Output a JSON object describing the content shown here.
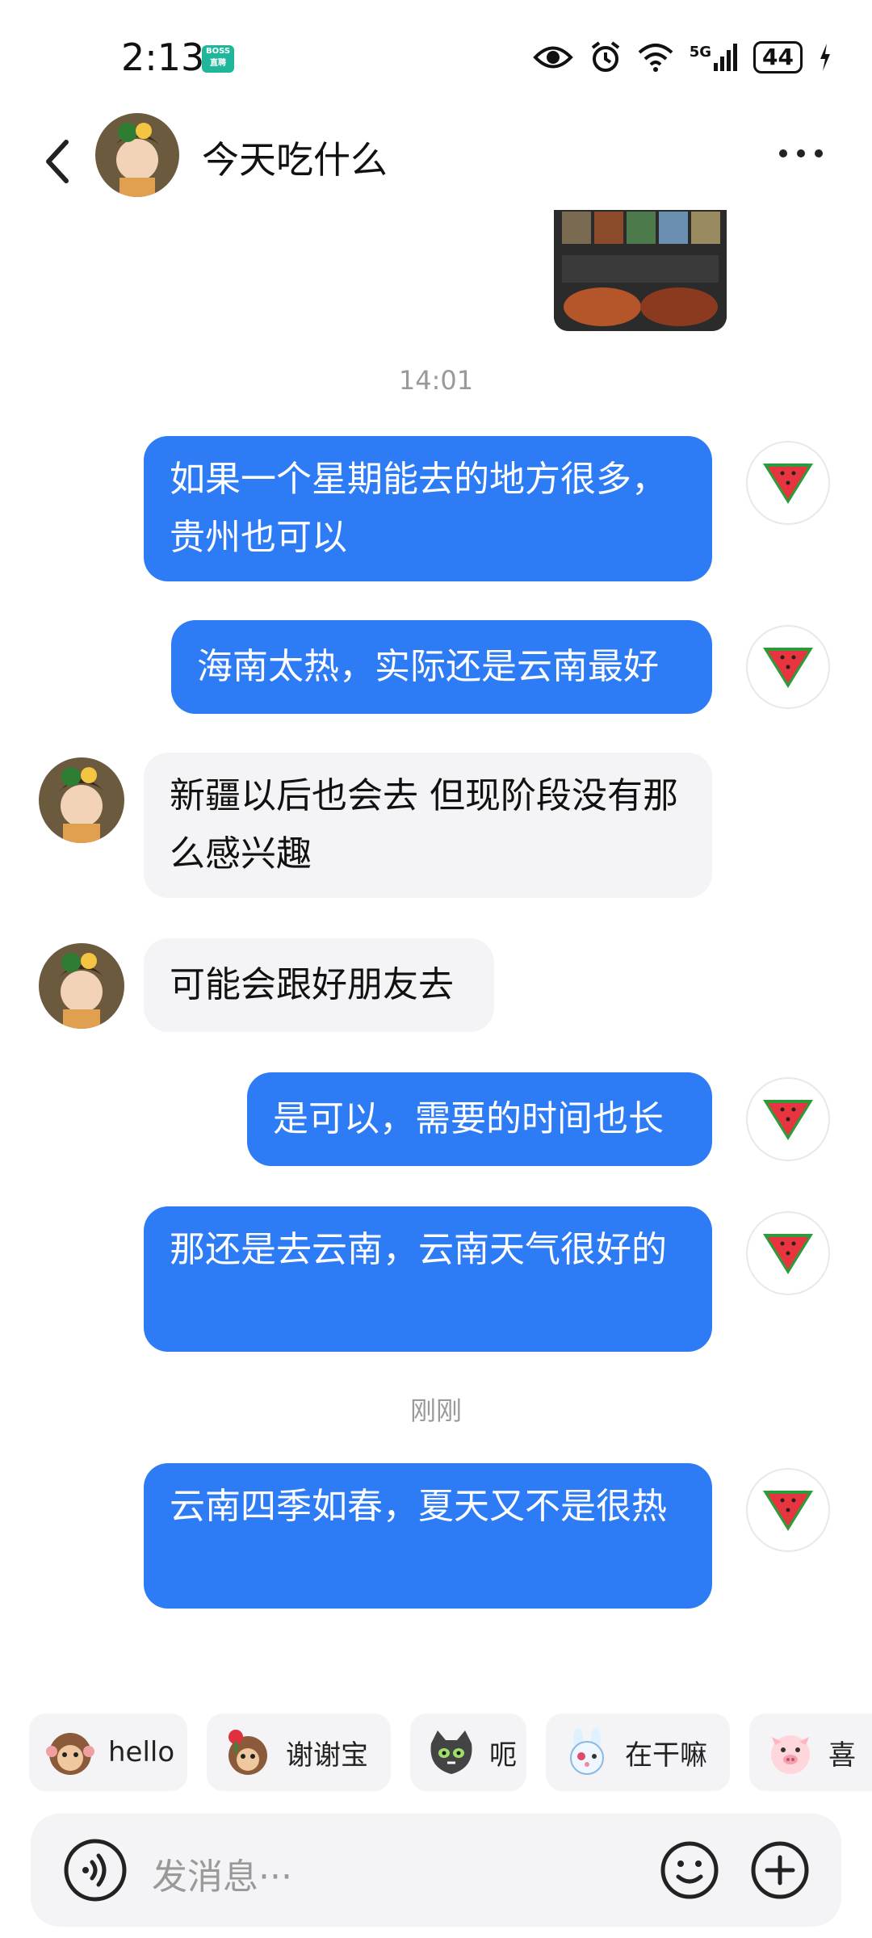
{
  "status_bar": {
    "time": "2:13",
    "app_badge": "BOSS\n直聘",
    "network": "5G",
    "battery": "44"
  },
  "header": {
    "title": "今天吃什么"
  },
  "chat": {
    "timestamps": [
      "14:01",
      "刚刚"
    ],
    "messages": [
      {
        "side": "out",
        "text": "如果一个星期能去的地方很多，贵州也可以"
      },
      {
        "side": "out",
        "text": "海南太热，实际还是云南最好"
      },
      {
        "side": "in",
        "text": "新疆以后也会去 但现阶段没有那么感兴趣"
      },
      {
        "side": "in",
        "text": "可能会跟好朋友去"
      },
      {
        "side": "out",
        "text": "是可以，需要的时间也长"
      },
      {
        "side": "out",
        "text": "那还是去云南，云南天气很好的"
      },
      {
        "side": "out",
        "text": "云南四季如春，夏天又不是很热"
      }
    ]
  },
  "quick_replies": [
    {
      "label": "hello",
      "icon": "monkey-emoji"
    },
    {
      "label": "谢谢宝",
      "icon": "monkey-rose-emoji"
    },
    {
      "label": "呃",
      "icon": "cat-emoji"
    },
    {
      "label": "在干嘛",
      "icon": "bunny-emoji"
    },
    {
      "label": "喜",
      "icon": "pig-emoji"
    }
  ],
  "input": {
    "placeholder": "发消息···"
  },
  "colors": {
    "outgoing_bubble": "#2d7cf6",
    "incoming_bubble": "#f4f4f6",
    "boss_badge": "#1fb69b"
  }
}
